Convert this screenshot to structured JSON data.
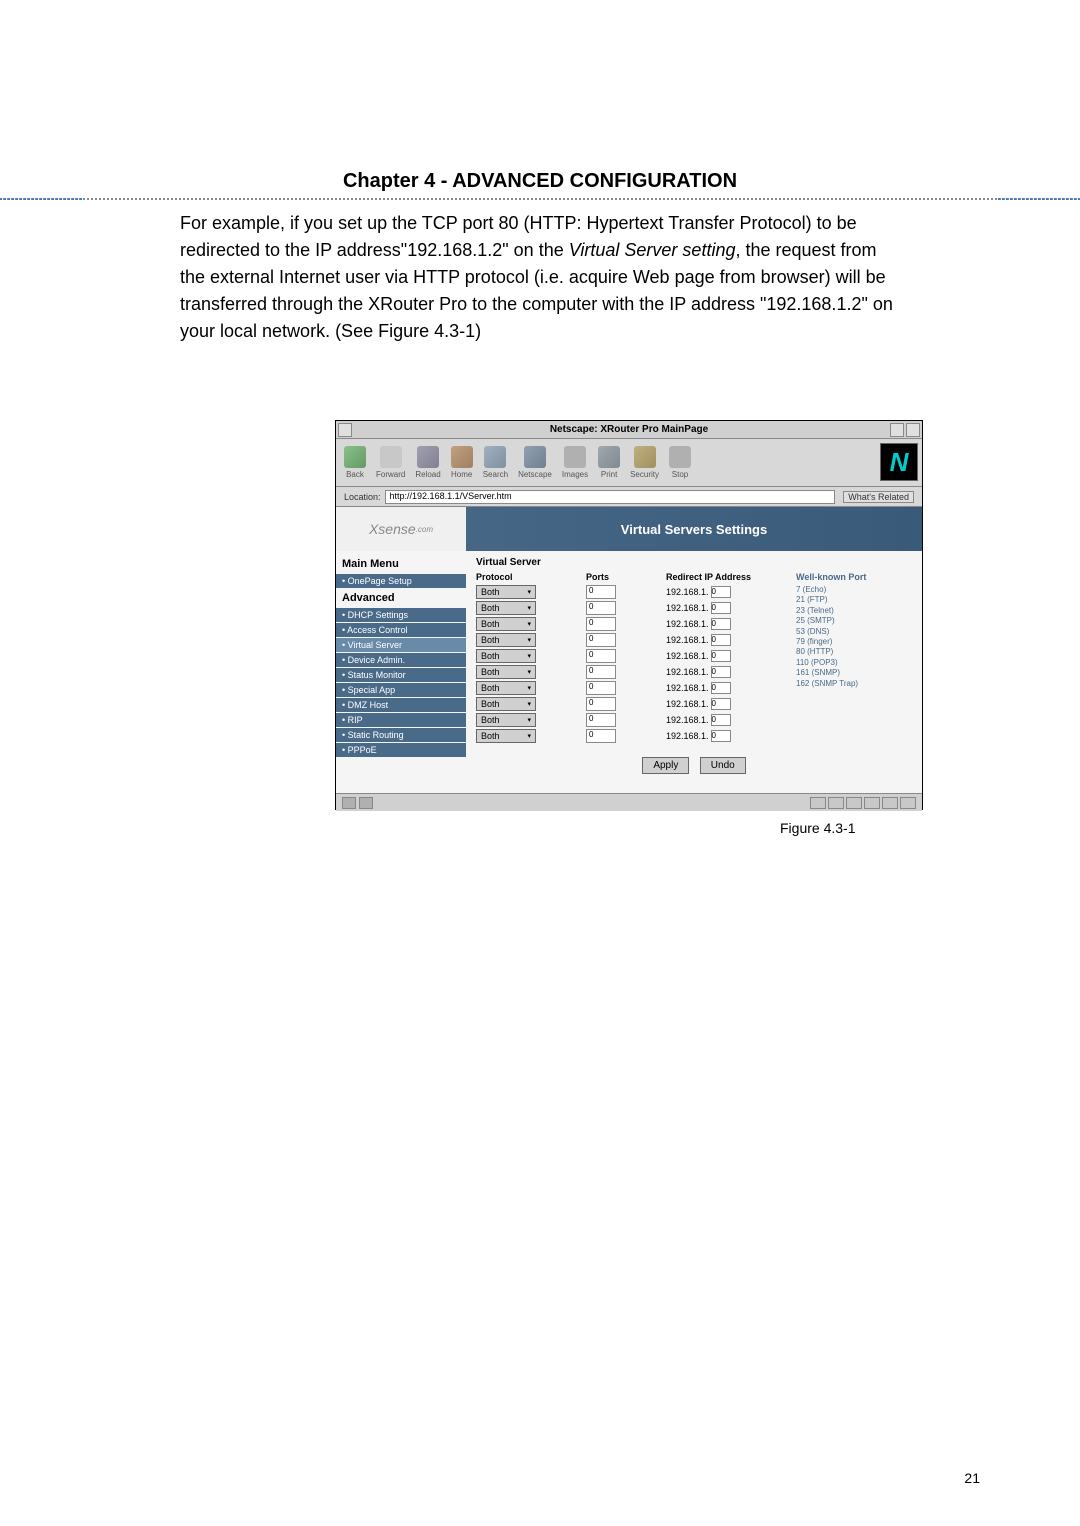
{
  "chapter": {
    "title": "Chapter 4 - ADVANCED CONFIGURATION"
  },
  "body": {
    "paragraph": "For example, if you set up the TCP port 80 (HTTP: Hypertext Transfer Protocol) to be redirected to the IP address\"192.168.1.2\" on the ",
    "em1": "Virtual Server setting",
    "paragraph2": ", the request from the external Internet user via HTTP protocol (i.e. acquire Web page from browser) will be transferred through the XRouter Pro to the computer with the IP address \"192.168.1.2\" on your local network.   (See Figure 4.3-1)"
  },
  "window": {
    "title": "Netscape: XRouter Pro MainPage"
  },
  "toolbar": {
    "back": "Back",
    "forward": "Forward",
    "reload": "Reload",
    "home": "Home",
    "search": "Search",
    "netscape": "Netscape",
    "images": "Images",
    "print": "Print",
    "security": "Security",
    "stop": "Stop"
  },
  "location": {
    "label": "Location:",
    "url": "http://192.168.1.1/VServer.htm",
    "whats_related": "What's Related"
  },
  "banner": {
    "logo": "Xsense",
    "logo_suffix": ".com",
    "title": "Virtual Servers Settings"
  },
  "sidebar": {
    "main_menu": "Main Menu",
    "onepage": "• OnePage Setup",
    "advanced": "Advanced",
    "items": [
      "• DHCP Settings",
      "• Access Control",
      "• Virtual Server",
      "• Device Admin.",
      "• Status Monitor",
      "• Special App",
      "• DMZ Host",
      "• RIP",
      "• Static Routing",
      "• PPPoE"
    ]
  },
  "form": {
    "heading": "Virtual Server",
    "protocol_label": "Protocol",
    "ports_label": "Ports",
    "redirect_label": "Redirect IP Address",
    "protocol_option": "Both",
    "ip_prefix": "192.168.1.",
    "ip_last": "0",
    "wellknown_title": "Well-known Port",
    "wellknown_ports": [
      "7 (Echo)",
      "21 (FTP)",
      "23 (Telnet)",
      "25 (SMTP)",
      "53 (DNS)",
      "79 (finger)",
      "80 (HTTP)",
      "110 (POP3)",
      "161 (SNMP)",
      "162 (SNMP Trap)"
    ],
    "apply": "Apply",
    "undo": "Undo"
  },
  "figure": {
    "caption": "Figure 4.3-1"
  },
  "page": {
    "number": "21"
  }
}
